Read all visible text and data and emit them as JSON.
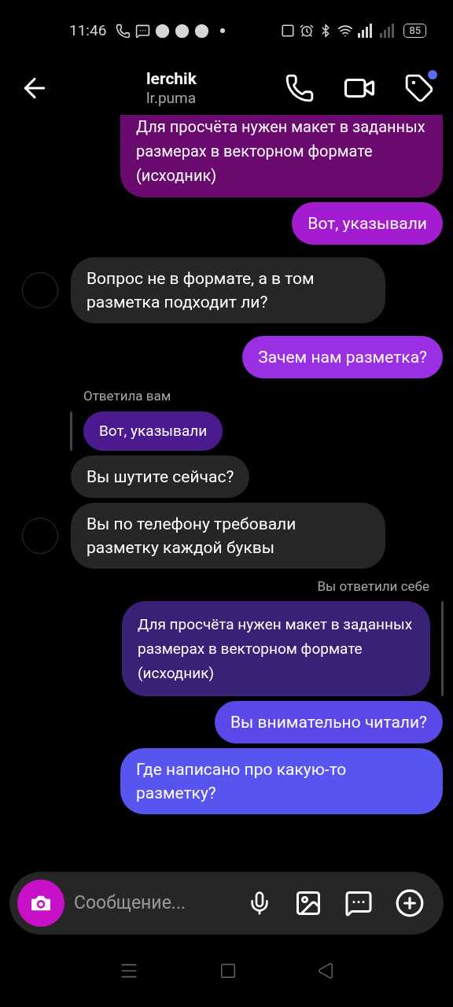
{
  "status_bar": {
    "time": "11:46",
    "battery": "85"
  },
  "header": {
    "name": "lerchik",
    "username": "lr.puma",
    "tag_badge": true
  },
  "messages": [
    {
      "kind": "out_cut",
      "text": "Для просчёта нужен макет в заданных размерах в векторном формате (исходник)",
      "color": "#6b0a6e"
    },
    {
      "kind": "out",
      "text": "Вот, указывали",
      "color": "#a31ccf"
    },
    {
      "kind": "in",
      "text": "Вопрос не в формате, а в том разметка подходит ли?",
      "avatar": true
    },
    {
      "kind": "out",
      "text": "Зачем нам разметка?",
      "color": "#9a2fe3"
    },
    {
      "kind": "reply_label_in",
      "text": "Ответила вам"
    },
    {
      "kind": "quote_in",
      "text": "Вот, указывали",
      "color": "#4b1a8e"
    },
    {
      "kind": "in",
      "text": "Вы шутите сейчас?",
      "avatar": false
    },
    {
      "kind": "in",
      "text": "Вы по телефону требовали разметку каждой буквы",
      "avatar": true
    },
    {
      "kind": "reply_label_out",
      "text": "Вы ответили себе"
    },
    {
      "kind": "quote_out",
      "text": "Для просчёта нужен макет в заданных размерах в векторном формате (исходник)",
      "color": "#3a2178"
    },
    {
      "kind": "out",
      "text": "Вы внимательно читали?",
      "color": "#5a48e8"
    },
    {
      "kind": "out",
      "text": "Где написано про какую-то разметку?",
      "color": "#5854ef"
    }
  ],
  "composer": {
    "placeholder": "Сообщение..."
  }
}
